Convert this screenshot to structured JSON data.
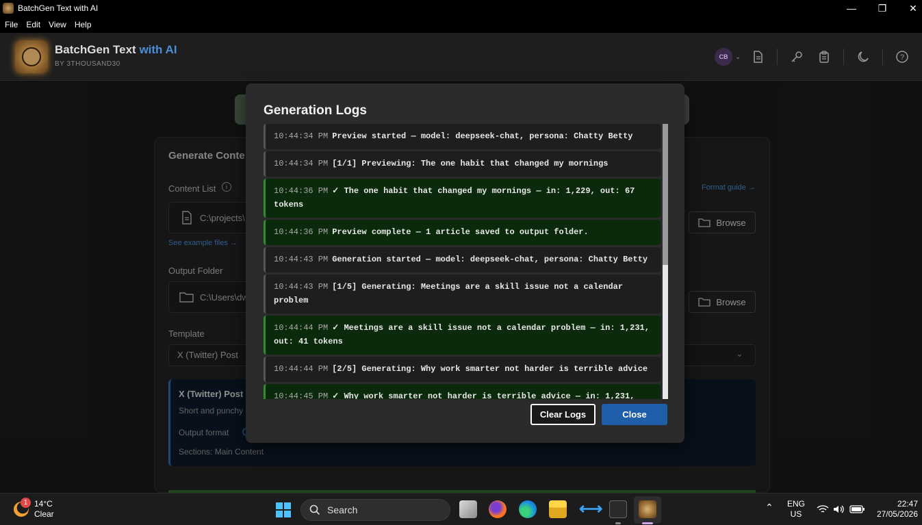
{
  "window": {
    "title": "BatchGen Text with AI"
  },
  "menu": [
    "File",
    "Edit",
    "View",
    "Help"
  ],
  "header": {
    "brand_main": "BatchGen Text",
    "brand_accent": "with AI",
    "byline": "BY 3THOUSAND30",
    "avatar_initials": "CB"
  },
  "background": {
    "panel_title": "Generate Conte",
    "content_list_label": "Content List",
    "content_list_value": "C:\\projects\\",
    "format_guide": "Format guide →",
    "see_examples": "See example files →",
    "browse": "Browse",
    "output_folder_label": "Output Folder",
    "output_folder_value": "C:\\Users\\dw",
    "template_label": "Template",
    "template_value": "X (Twitter) Post",
    "template_info_title": "X (Twitter) Post",
    "template_info_desc": "Short and punchy",
    "output_format_label": "Output format",
    "sections_text": "Sections: Main Content"
  },
  "modal": {
    "title": "Generation Logs",
    "entries": [
      {
        "ts": "10:44:34 PM",
        "msg": "Preview started — model: deepseek-chat, persona: Chatty Betty",
        "type": "info"
      },
      {
        "ts": "10:44:34 PM",
        "msg": "[1/1] Previewing: The one habit that changed my mornings",
        "type": "info"
      },
      {
        "ts": "10:44:36 PM",
        "msg": "✓ The one habit that changed my mornings — in: 1,229, out: 67 tokens",
        "type": "ok"
      },
      {
        "ts": "10:44:36 PM",
        "msg": "Preview complete — 1 article saved to output folder.",
        "type": "ok"
      },
      {
        "ts": "10:44:43 PM",
        "msg": "Generation started — model: deepseek-chat, persona: Chatty Betty",
        "type": "info"
      },
      {
        "ts": "10:44:43 PM",
        "msg": "[1/5] Generating: Meetings are a skill issue not a calendar problem",
        "type": "info"
      },
      {
        "ts": "10:44:44 PM",
        "msg": "✓ Meetings are a skill issue not a calendar problem — in: 1,231, out: 41 tokens",
        "type": "ok"
      },
      {
        "ts": "10:44:44 PM",
        "msg": "[2/5] Generating: Why work smarter not harder is terrible advice",
        "type": "info"
      },
      {
        "ts": "10:44:45 PM",
        "msg": "✓ Why work smarter not harder is terrible advice — in: 1,231,",
        "type": "ok"
      }
    ],
    "clear_label": "Clear Logs",
    "close_label": "Close"
  },
  "taskbar": {
    "weather_temp": "14°C",
    "weather_desc": "Clear",
    "weather_badge": "1",
    "search_label": "Search",
    "lang_top": "ENG",
    "lang_bottom": "US",
    "time": "22:47",
    "date": "27/05/2026"
  }
}
